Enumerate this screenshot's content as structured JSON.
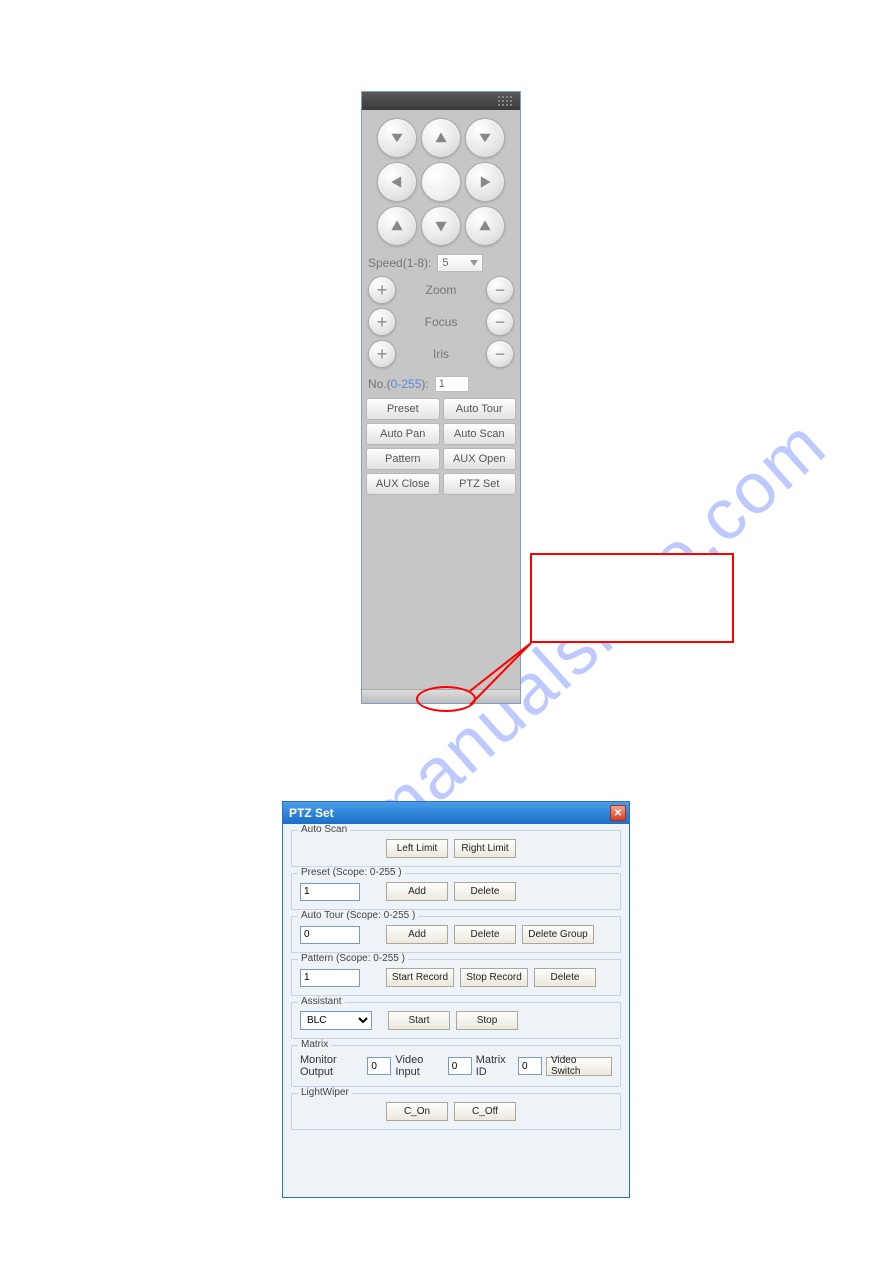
{
  "watermark": "manualshive.com",
  "panel": {
    "speed": {
      "label": "Speed(1-8):",
      "value": "5"
    },
    "zoom_label": "Zoom",
    "focus_label": "Focus",
    "iris_label": "Iris",
    "no": {
      "label_prefix": "No.(",
      "range": "0-255",
      "label_suffix": "):",
      "value": "1"
    },
    "buttons": {
      "preset": "Preset",
      "auto_tour": "Auto Tour",
      "auto_pan": "Auto Pan",
      "auto_scan": "Auto Scan",
      "pattern": "Pattern",
      "aux_open": "AUX Open",
      "aux_close": "AUX Close",
      "ptz_set": "PTZ Set"
    }
  },
  "dialog": {
    "title": "PTZ Set",
    "auto_scan": {
      "legend": "Auto Scan",
      "left": "Left Limit",
      "right": "Right Limit"
    },
    "preset": {
      "legend": "Preset (Scope: 0-255 )",
      "value": "1",
      "add": "Add",
      "delete": "Delete"
    },
    "auto_tour": {
      "legend": "Auto Tour (Scope: 0-255 )",
      "value": "0",
      "add": "Add",
      "delete": "Delete",
      "delete_group": "Delete Group"
    },
    "pattern": {
      "legend": "Pattern (Scope: 0-255 )",
      "value": "1",
      "start": "Start Record",
      "stop": "Stop Record",
      "delete": "Delete"
    },
    "assistant": {
      "legend": "Assistant",
      "selected": "BLC",
      "start": "Start",
      "stop": "Stop"
    },
    "matrix": {
      "legend": "Matrix",
      "monitor_output_label": "Monitor Output",
      "monitor_output": "0",
      "video_input_label": "Video Input",
      "video_input": "0",
      "matrix_id_label": "Matrix ID",
      "matrix_id": "0",
      "switch": "Video Switch"
    },
    "light_wiper": {
      "legend": "LightWiper",
      "on": "C_On",
      "off": "C_Off"
    }
  }
}
